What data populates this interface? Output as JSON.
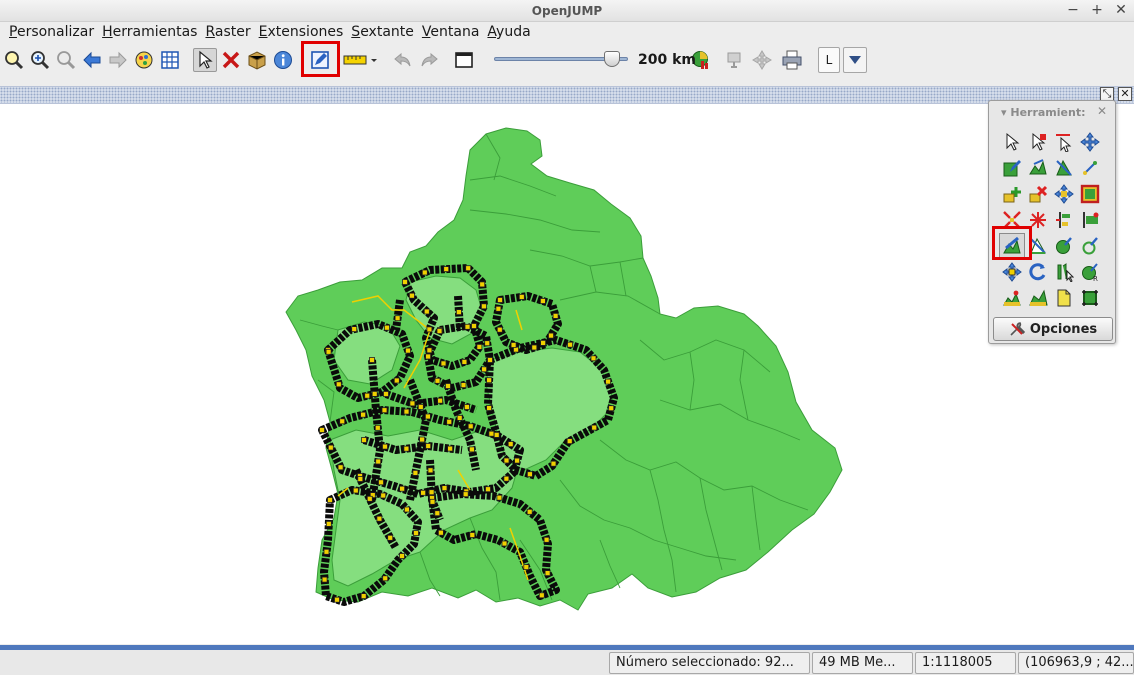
{
  "window": {
    "title": "OpenJUMP",
    "controls": [
      "−",
      "+",
      "✕"
    ]
  },
  "menu": [
    "Personalizar",
    "Herramientas",
    "Raster",
    "Extensiones",
    "Sextante",
    "Ventana",
    "Ayuda"
  ],
  "toolbar": {
    "icons": [
      "zoom-in-icon",
      "zoom-plus-icon",
      "zoom-out-icon",
      "pan-back-icon",
      "pan-forward-icon",
      "layer-view-icon",
      "grid-icon",
      "select-arrow-icon",
      "delete-red-x-icon",
      "package-icon",
      "info-icon",
      "edit-toolbox-icon",
      "measure-ruler-icon",
      "undo-icon",
      "redo-icon",
      "window-icon",
      "scale-chart-icon",
      "print-icon",
      "move-cross-icon",
      "printer-icon"
    ],
    "scale_label": "200 km",
    "scale_slider_fraction": 0.93,
    "layer_letter": "L",
    "highlighted_tool": "edit-toolbox-icon"
  },
  "palette": {
    "title": "Herramient:",
    "close_glyph": "✕",
    "options_label": "Opciones",
    "highlighted_tool": "draw-polygon-icon",
    "tools": [
      "select-feature-icon",
      "select-part-icon",
      "select-line-string-icon",
      "move-vertex-icon",
      "draw-rectangle-icon",
      "draw-linestring-icon",
      "cut-feature-icon",
      "snap-vertex-icon",
      "add-vertex-icon",
      "delete-vertex-icon",
      "move-feature-icon",
      "draw-box-icon",
      "split-icon",
      "merge-icon",
      "align-icon",
      "extend-icon",
      "draw-polygon-icon",
      "draw-arc-icon",
      "draw-circle-icon",
      "draw-curve-icon",
      "move-selection-icon",
      "rotate-icon",
      "scale-feature-icon",
      "auto-complete-icon",
      "fill-polygon-icon",
      "draw-point-icon",
      "new-layer-icon",
      "bounding-box-icon"
    ]
  },
  "statusbar": {
    "selected": "Número seleccionado: 92...",
    "memory": "49 MB Me...",
    "scale": "1:1118005",
    "coords": "(106963,9 ; 42..."
  },
  "colors": {
    "region_fill": "#5fcd59",
    "subregion_fill": "#85de7f",
    "region_stroke": "#3b9e3a",
    "route_stroke": "#0a0a0a",
    "vertex_fill": "#f0d000",
    "highlight": "#e00000",
    "accent_blue": "#4f78bd"
  }
}
